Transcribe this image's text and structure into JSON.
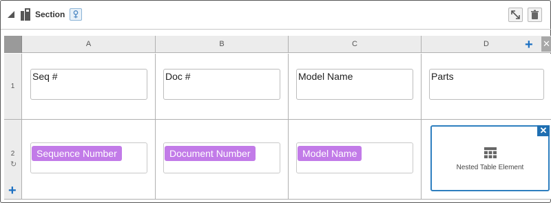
{
  "section": {
    "title": "Section"
  },
  "table": {
    "columns": [
      "A",
      "B",
      "C",
      "D"
    ],
    "rows": [
      "1",
      "2"
    ],
    "row1": [
      "Seq #",
      "Doc #",
      "Model Name",
      "Parts"
    ],
    "row2": [
      "Sequence Number",
      "Document Number",
      "Model Name"
    ],
    "nested_label": "Nested Table Element"
  },
  "icons": {
    "collapse": "collapse-triangle-icon",
    "doc": "document-icon",
    "edit": "edit-section-icon",
    "expand": "expand-icon",
    "trash": "trash-icon",
    "add_column": "plus-icon",
    "add_row": "plus-icon",
    "remove": "close-icon",
    "table": "table-icon",
    "refresh": "refresh-icon"
  },
  "colors": {
    "pill": "#c27be8",
    "accent": "#1b6fc2",
    "selected_border": "#2d7ebf"
  }
}
